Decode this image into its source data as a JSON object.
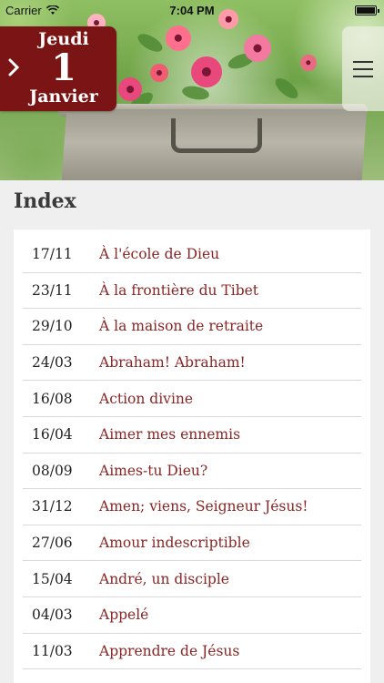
{
  "status_bar": {
    "carrier": "Carrier",
    "time": "7:04 PM"
  },
  "header": {
    "date": {
      "weekday": "Jeudi",
      "day": "1",
      "month": "Janvier"
    },
    "icons": {
      "prev": "chevron-right-icon",
      "menu": "hamburger-menu-icon"
    },
    "colors": {
      "badge": "#7b1414"
    }
  },
  "index": {
    "title": "Index",
    "items": [
      {
        "date": "17/11",
        "title": "À l'école de Dieu"
      },
      {
        "date": "23/11",
        "title": "À la frontière du Tibet"
      },
      {
        "date": "29/10",
        "title": "À la maison de retraite"
      },
      {
        "date": "24/03",
        "title": "Abraham! Abraham!"
      },
      {
        "date": "16/08",
        "title": "Action divine"
      },
      {
        "date": "16/04",
        "title": "Aimer mes ennemis"
      },
      {
        "date": "08/09",
        "title": "Aimes-tu Dieu?"
      },
      {
        "date": "31/12",
        "title": "Amen; viens, Seigneur Jésus!"
      },
      {
        "date": "27/06",
        "title": "Amour indescriptible"
      },
      {
        "date": "15/04",
        "title": "André, un disciple"
      },
      {
        "date": "04/03",
        "title": "Appelé"
      },
      {
        "date": "11/03",
        "title": "Apprendre de Jésus"
      }
    ],
    "colors": {
      "link": "#8a2525"
    }
  }
}
